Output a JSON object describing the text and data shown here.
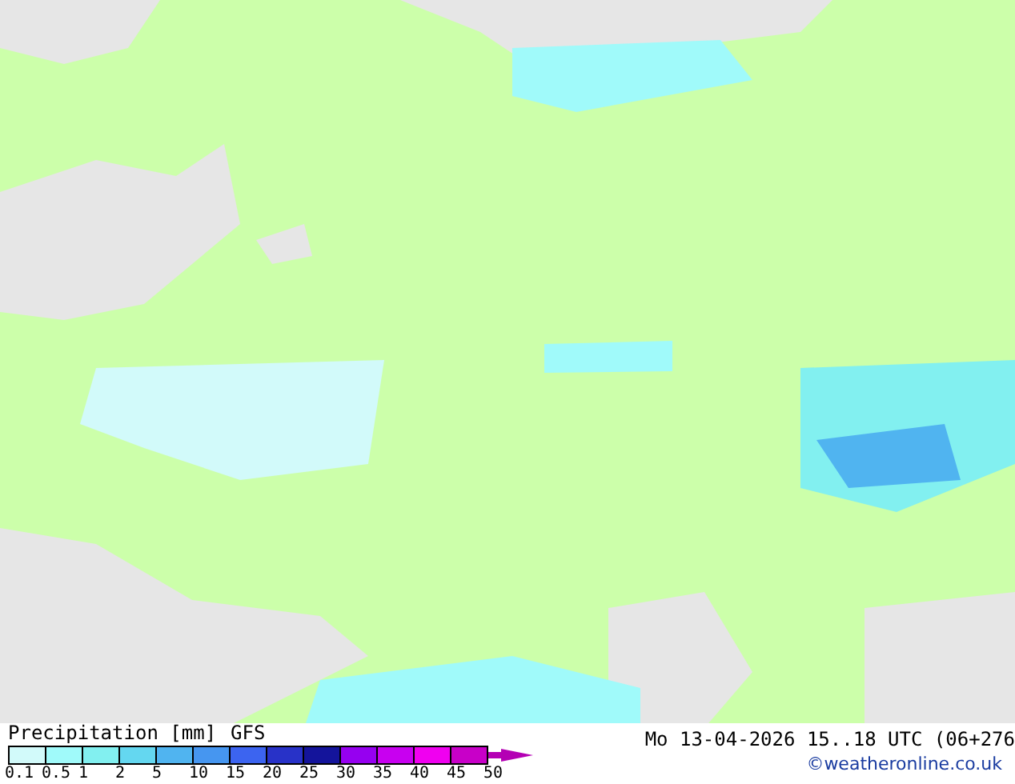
{
  "map": {
    "kind": "precipitation"
  },
  "legend": {
    "title": "Precipitation [mm]",
    "model": "GFS",
    "swatches": [
      {
        "color": "#d2fafa"
      },
      {
        "color": "#a0fafa"
      },
      {
        "color": "#82f0f0"
      },
      {
        "color": "#64d7f0"
      },
      {
        "color": "#50b4f0"
      },
      {
        "color": "#4696f0"
      },
      {
        "color": "#3c64f0"
      },
      {
        "color": "#2832c8"
      },
      {
        "color": "#14149b"
      },
      {
        "color": "#9600f0"
      },
      {
        "color": "#c800f0"
      },
      {
        "color": "#f000f0"
      },
      {
        "color": "#c800c8"
      }
    ],
    "labels": [
      "0.1",
      "0.5",
      "1",
      "2",
      "5",
      "10",
      "15",
      "20",
      "25",
      "30",
      "35",
      "40",
      "45",
      "50"
    ]
  },
  "valid_time": "Mo 13-04-2026 15..18 UTC (06+276",
  "credit": "©weatheronline.co.uk"
}
